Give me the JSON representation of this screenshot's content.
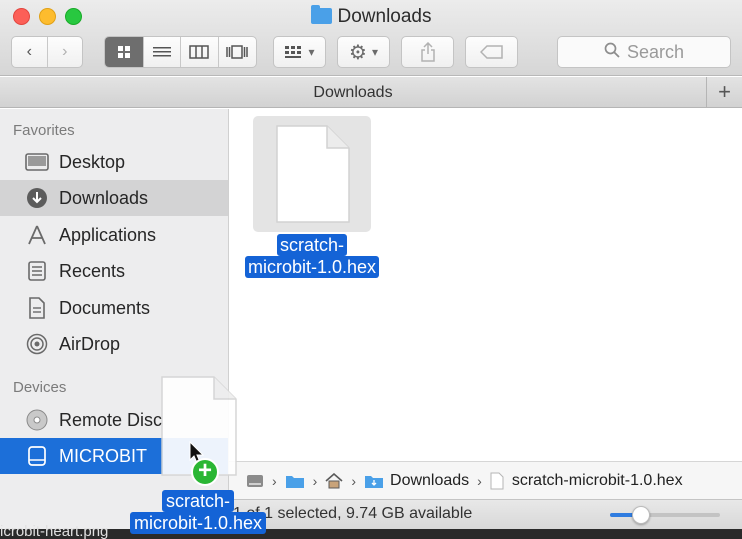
{
  "window": {
    "title": "Downloads",
    "path_bar_title": "Downloads"
  },
  "toolbar": {
    "back_icon": "chevron-left-icon",
    "forward_icon": "chevron-right-icon",
    "view_modes": [
      "icon-view",
      "list-view",
      "column-view",
      "cover-flow-view"
    ],
    "active_view": "icon-view",
    "search_placeholder": "Search"
  },
  "sidebar": {
    "favorites_heading": "Favorites",
    "favorites": [
      {
        "label": "Desktop",
        "icon": "desktop-icon"
      },
      {
        "label": "Downloads",
        "icon": "downloads-icon",
        "selected": true
      },
      {
        "label": "Applications",
        "icon": "applications-icon"
      },
      {
        "label": "Recents",
        "icon": "recents-icon"
      },
      {
        "label": "Documents",
        "icon": "documents-icon"
      },
      {
        "label": "AirDrop",
        "icon": "airdrop-icon"
      }
    ],
    "devices_heading": "Devices",
    "devices": [
      {
        "label": "Remote Disc",
        "icon": "disc-icon"
      },
      {
        "label": "MICROBIT",
        "icon": "drive-icon",
        "selected": true
      }
    ]
  },
  "content": {
    "files": [
      {
        "line1": "scratch-",
        "line2": "microbit-1.0.hex",
        "selected": true
      }
    ]
  },
  "path": {
    "crumbs": [
      "",
      "",
      "",
      "Downloads",
      "scratch-microbit-1.0.hex"
    ]
  },
  "status": {
    "text": "1 of 1 selected, 9.74 GB available",
    "icon_size_slider": 0.28
  },
  "drag": {
    "line1": "scratch-",
    "line2": "microbit-1.0.hex"
  },
  "desktop": {
    "partial_file": "icrobit-heart.png"
  },
  "colors": {
    "selection_blue": "#1463d6",
    "sidebar_selected_blue": "#1c6fd9",
    "add_badge_green": "#2ab634"
  }
}
